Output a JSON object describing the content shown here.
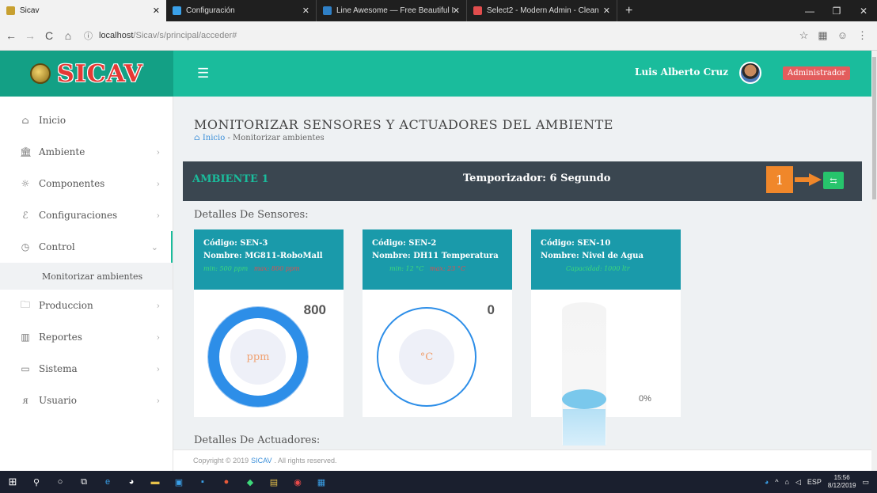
{
  "browser": {
    "tabs": [
      {
        "label": "Sicav",
        "active": true,
        "favicon_color": "#c8a030"
      },
      {
        "label": "Configuración",
        "active": false,
        "favicon_color": "#3aa0e8"
      },
      {
        "label": "Line Awesome — Free Beautiful I",
        "active": false,
        "favicon_color": "#2f80c7"
      },
      {
        "label": "Select2 - Modern Admin - Clean",
        "active": false,
        "favicon_color": "#e14d4d"
      }
    ],
    "address_host": "localhost",
    "address_path": "/Sicav/s/principal/acceder#"
  },
  "header": {
    "brand": "SICAV",
    "user_name": "Luis Alberto Cruz",
    "role": "Administrador"
  },
  "sidebar": {
    "items": [
      {
        "label": "Inicio",
        "icon": "home-icon",
        "chevron": false
      },
      {
        "label": "Ambiente",
        "icon": "bank-icon",
        "chevron": true
      },
      {
        "label": "Componentes",
        "icon": "components-icon",
        "chevron": true
      },
      {
        "label": "Configuraciones",
        "icon": "wrench-icon",
        "chevron": true
      },
      {
        "label": "Control",
        "icon": "gauge-icon",
        "chevron": true
      },
      {
        "label": "Produccion",
        "icon": "folder-icon",
        "chevron": true
      },
      {
        "label": "Reportes",
        "icon": "chart-icon",
        "chevron": true
      },
      {
        "label": "Sistema",
        "icon": "window-icon",
        "chevron": true
      },
      {
        "label": "Usuario",
        "icon": "users-icon",
        "chevron": true
      }
    ],
    "sub_item": "Monitorizar ambientes"
  },
  "main": {
    "title": "MONITORIZAR SENSORES Y ACTUADORES DEL AMBIENTE",
    "breadcrumb_home": "Inicio",
    "breadcrumb_sep": "-",
    "breadcrumb_current": "Monitorizar ambientes",
    "ambient_name": "AMBIENTE 1",
    "timer": "Temporizador: 6 Segundo",
    "callout": "1",
    "sensors_title": "Detalles De Sensores:",
    "actuators_title": "Detalles De Actuadores:",
    "sensors": [
      {
        "code": "Código: SEN-3",
        "name": "Nombre: MG811-RoboMall",
        "min": "min: 500 ppm",
        "max": "max: 800 ppm",
        "value": "800",
        "unit": "ppm",
        "level": 1.0
      },
      {
        "code": "Código: SEN-2",
        "name": "Nombre: DH11 Temperatura",
        "min": "min: 12 °C",
        "max": "max: 23 °C",
        "value": "0",
        "unit": "°C",
        "level": 0.0
      },
      {
        "code": "Código: SEN-10",
        "name": "Nombre: Nivel de Agua",
        "capacity": "Capacidad: 1000 ltr",
        "value": "0%",
        "level": 0.0
      }
    ]
  },
  "footer": {
    "prefix": "Copyright © 2019",
    "link": "SICAV",
    "suffix": ". All rights reserved."
  },
  "taskbar": {
    "language": "ESP",
    "time": "15:56",
    "date": "8/12/2019"
  },
  "colors": {
    "primary": "#1abc9c",
    "card_header": "#1a9aaa",
    "gauge_blue": "#2d8ee8",
    "badge_red": "#e35d5d",
    "back_button": "#27c46c",
    "callout": "#f0872a"
  }
}
